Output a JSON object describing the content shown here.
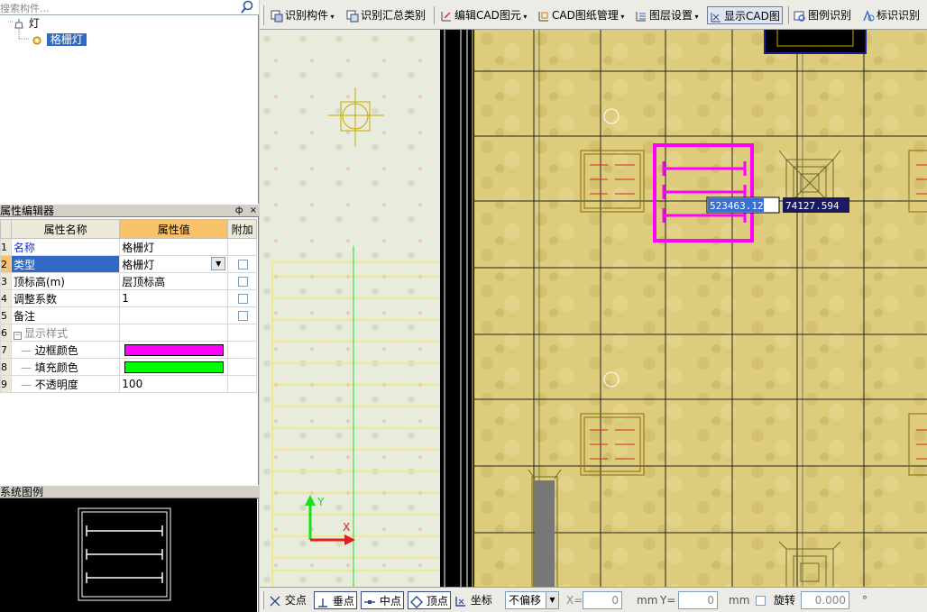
{
  "left_panel": {
    "search_placeholder": "搜索构件...",
    "tree": {
      "root_label": "灯",
      "child_label": "格栅灯"
    },
    "prop_editor": {
      "title": "属性编辑器",
      "pin_glyph": "ф",
      "close_glyph": "×",
      "headers": {
        "name": "属性名称",
        "value": "属性值",
        "extra": "附加"
      },
      "rows": [
        {
          "idx": "1",
          "key": "名称",
          "value": "格栅灯"
        },
        {
          "idx": "2",
          "key": "类型",
          "value": "格栅灯"
        },
        {
          "idx": "3",
          "key": "顶标高(m)",
          "value": "层顶标高"
        },
        {
          "idx": "4",
          "key": "调整系数",
          "value": "1"
        },
        {
          "idx": "5",
          "key": "备注",
          "value": ""
        },
        {
          "idx": "6",
          "key": "显示样式",
          "value": ""
        },
        {
          "idx": "7",
          "key": "边框颜色",
          "value": ""
        },
        {
          "idx": "8",
          "key": "填充颜色",
          "value": ""
        },
        {
          "idx": "9",
          "key": "不透明度",
          "value": "100"
        }
      ],
      "border_color": "#ff00ff",
      "fill_color": "#00ff00"
    },
    "legend": {
      "title": "系统图例"
    }
  },
  "toolbar": {
    "items": [
      {
        "label": "识别构件"
      },
      {
        "label": "识别汇总类别"
      },
      {
        "label": "编辑CAD图元"
      },
      {
        "label": "CAD图纸管理"
      },
      {
        "label": "图层设置"
      },
      {
        "label": "显示CAD图"
      },
      {
        "label": "图例识别"
      },
      {
        "label": "标识识别"
      }
    ]
  },
  "canvas": {
    "coord_x": "523463.125",
    "coord_y": "74127.594",
    "axis_y_label": "Y",
    "axis_x_label": "X",
    "highlight_color": "#ff00ff"
  },
  "statusbar": {
    "snap_intersect": "交点",
    "snap_perp": "垂点",
    "snap_mid": "中点",
    "snap_vertex": "顶点",
    "snap_coord": "坐标",
    "offset_mode": "不偏移",
    "x_label": "X=",
    "x_value": "0",
    "unit1": "mm",
    "y_label": "Y=",
    "y_value": "0",
    "unit2": "mm",
    "rotate_label": "旋转",
    "rotate_value": "0.000",
    "degree": "°"
  }
}
